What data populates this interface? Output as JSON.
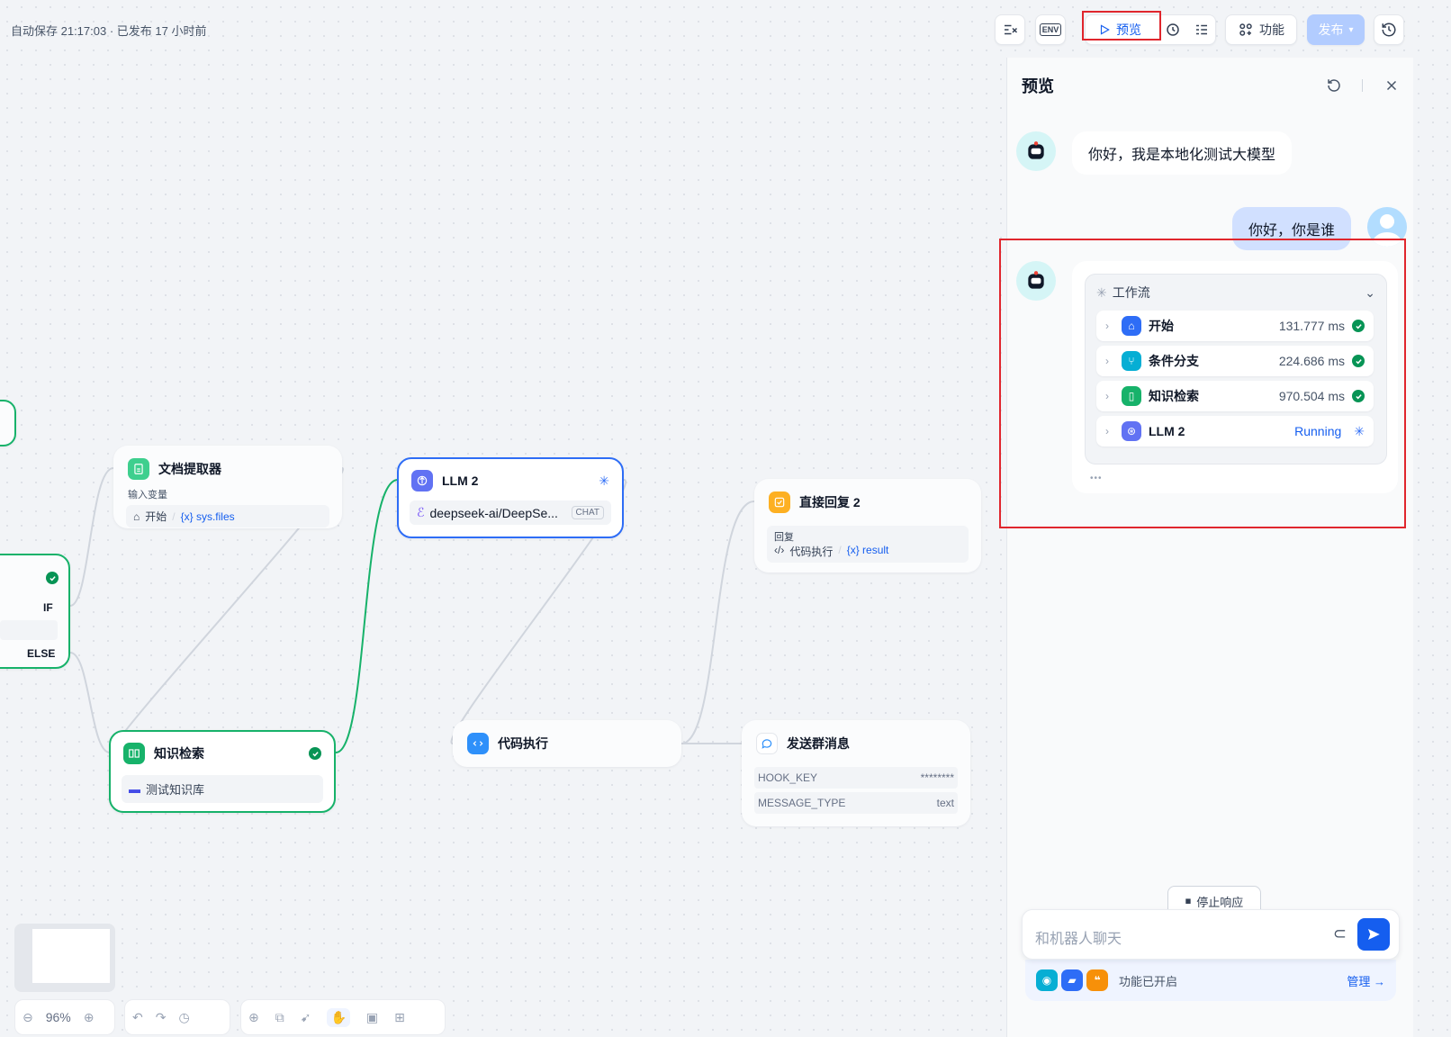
{
  "topbar": {
    "autosave": "自动保存 21:17:03 · 已发布 17 小时前",
    "env_label": "ENV",
    "preview_label": "预览",
    "features_label": "功能",
    "publish_label": "发布"
  },
  "nodes": {
    "doc_extractor": {
      "title": "文档提取器",
      "input_label": "输入变量",
      "source": "开始",
      "sep": "/",
      "var": "{x} sys.files"
    },
    "if_else": {
      "if_label": "IF",
      "else_label": "ELSE"
    },
    "llm2": {
      "title": "LLM 2",
      "model": "deepseek-ai/DeepSe...",
      "mode": "CHAT"
    },
    "direct_reply": {
      "title": "直接回复 2",
      "reply_label": "回复",
      "source": "代码执行",
      "sep": "/",
      "var": "{x} result"
    },
    "knowledge": {
      "title": "知识检索",
      "dataset": "测试知识库"
    },
    "code": {
      "title": "代码执行"
    },
    "group_msg": {
      "title": "发送群消息",
      "rows": [
        {
          "key": "HOOK_KEY",
          "value": "********"
        },
        {
          "key": "MESSAGE_TYPE",
          "value": "text"
        }
      ]
    }
  },
  "zoom": "96%",
  "panel": {
    "title": "预览",
    "bot_greeting": "你好，我是本地化测试大模型",
    "user_message": "你好，你是谁",
    "workflow": {
      "label": "工作流",
      "steps": [
        {
          "name": "开始",
          "time": "131.777 ms",
          "status": "success",
          "color": "#2e6df6"
        },
        {
          "name": "条件分支",
          "time": "224.686 ms",
          "status": "success",
          "color": "#06aed4"
        },
        {
          "name": "知识检索",
          "time": "970.504 ms",
          "status": "success",
          "color": "#17b26a"
        },
        {
          "name": "LLM 2",
          "time": "Running",
          "status": "running",
          "color": "#6172f3"
        }
      ]
    },
    "stop_label": "停止响应",
    "input_placeholder": "和机器人聊天",
    "features_enabled": "功能已开启",
    "manage_label": "管理"
  }
}
